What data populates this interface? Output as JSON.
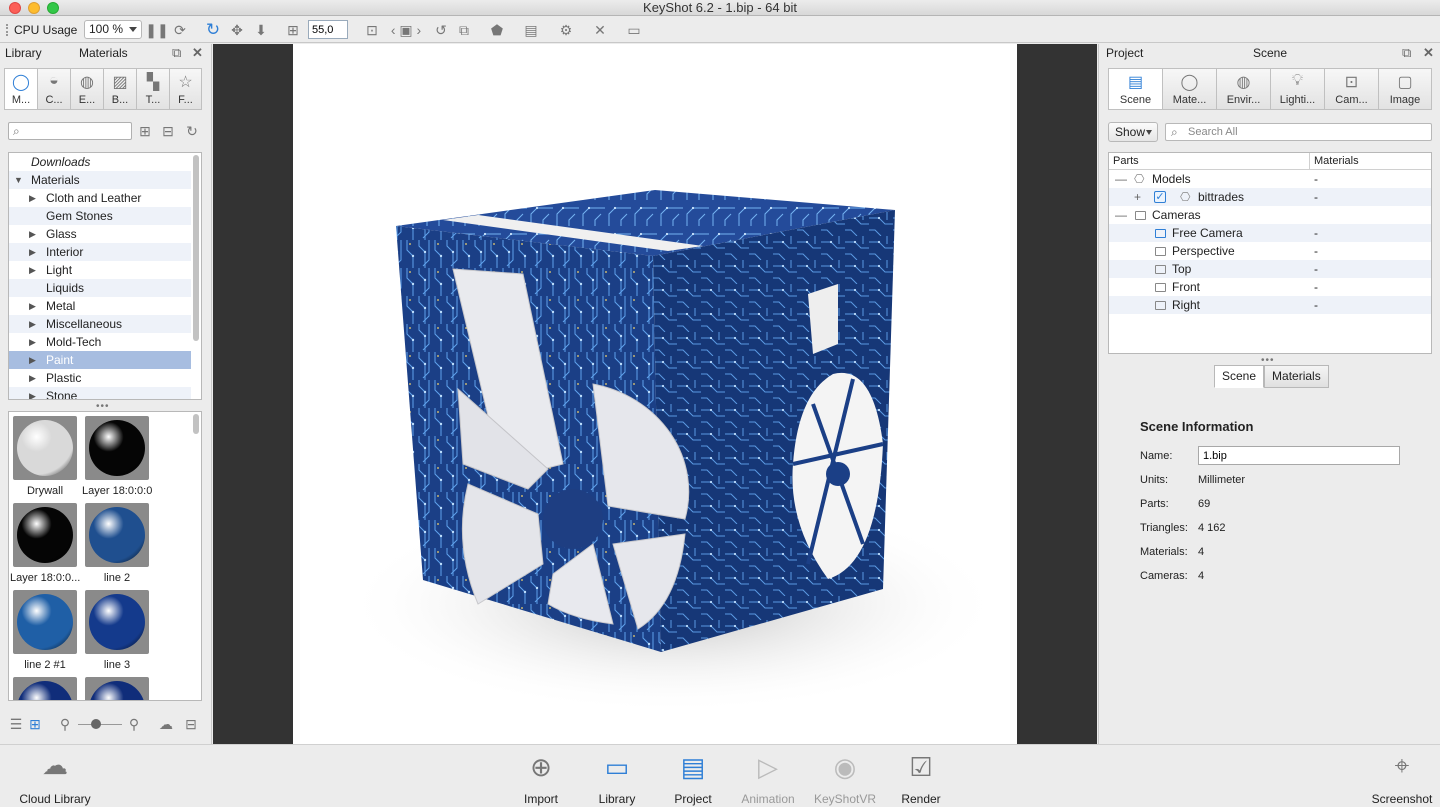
{
  "window": {
    "title": "KeyShot 6.2  - 1.bip  - 64 bit"
  },
  "toolbar": {
    "cpu_label": "CPU Usage",
    "cpu_value": "100 %",
    "fov_value": "55,0"
  },
  "library": {
    "header_left": "Library",
    "header_center": "Materials",
    "tabs": [
      {
        "label": "M...",
        "icon": "material-ball-icon",
        "active": true
      },
      {
        "label": "C...",
        "icon": "colors-icon",
        "active": false
      },
      {
        "label": "E...",
        "icon": "environment-icon",
        "active": false
      },
      {
        "label": "B...",
        "icon": "backplate-icon",
        "active": false
      },
      {
        "label": "T...",
        "icon": "texture-icon",
        "active": false
      },
      {
        "label": "F...",
        "icon": "favorites-icon",
        "active": false
      }
    ],
    "tree": [
      {
        "label": "Downloads",
        "italic": true,
        "indent": 0,
        "arrow": ""
      },
      {
        "label": "Materials",
        "indent": 0,
        "arrow": "▼"
      },
      {
        "label": "Cloth and Leather",
        "arrow": "▶"
      },
      {
        "label": "Gem Stones",
        "arrow": ""
      },
      {
        "label": "Glass",
        "arrow": "▶"
      },
      {
        "label": "Interior",
        "arrow": "▶"
      },
      {
        "label": "Light",
        "arrow": "▶"
      },
      {
        "label": "Liquids",
        "arrow": ""
      },
      {
        "label": "Metal",
        "arrow": "▶"
      },
      {
        "label": "Miscellaneous",
        "arrow": "▶"
      },
      {
        "label": "Mold-Tech",
        "arrow": "▶"
      },
      {
        "label": "Paint",
        "arrow": "▶",
        "selected": true
      },
      {
        "label": "Plastic",
        "arrow": "▶"
      },
      {
        "label": "Stone",
        "arrow": "▶"
      }
    ],
    "thumbnails": [
      {
        "label": "Drywall",
        "color": "#d9d9d9"
      },
      {
        "label": "Layer 18:0:0:0",
        "color": "#050505"
      },
      {
        "label": "Layer 18:0:0...",
        "color": "#050505"
      },
      {
        "label": "line 2",
        "color": "#1f4f8f"
      },
      {
        "label": "line 2 #1",
        "color": "#1f5fa6"
      },
      {
        "label": "line 3",
        "color": "#143a8c"
      },
      {
        "label": "",
        "color": "#102d7a"
      },
      {
        "label": "",
        "color": "#102d7a"
      }
    ]
  },
  "project": {
    "header_left": "Project",
    "header_center": "Scene",
    "tabs": [
      {
        "label": "Scene",
        "icon": "scene-list-icon",
        "active": true
      },
      {
        "label": "Mate...",
        "icon": "material-ball-icon",
        "active": false
      },
      {
        "label": "Envir...",
        "icon": "environment-icon",
        "active": false
      },
      {
        "label": "Lighti...",
        "icon": "lightbulb-icon",
        "active": false
      },
      {
        "label": "Cam...",
        "icon": "camera-icon",
        "active": false
      },
      {
        "label": "Image",
        "icon": "image-icon",
        "active": false
      }
    ],
    "show_label": "Show",
    "search_placeholder": "Search All",
    "columns": {
      "parts": "Parts",
      "materials": "Materials"
    },
    "tree": [
      {
        "label": "Models",
        "value": "-"
      },
      {
        "label": "bittrades",
        "value": "-"
      },
      {
        "label": "Cameras",
        "value": ""
      },
      {
        "label": "Free Camera",
        "value": "-"
      },
      {
        "label": "Perspective",
        "value": "-"
      },
      {
        "label": "Top",
        "value": "-"
      },
      {
        "label": "Front",
        "value": "-"
      },
      {
        "label": "Right",
        "value": "-"
      }
    ],
    "subtabs": [
      "Scene",
      "Materials"
    ],
    "info": {
      "title": "Scene Information",
      "name_label": "Name:",
      "name_value": "1.bip",
      "units_label": "Units:",
      "units_value": "Millimeter",
      "parts_label": "Parts:",
      "parts_value": "69",
      "triangles_label": "Triangles:",
      "triangles_value": "4 162",
      "materials_label": "Materials:",
      "materials_value": "4",
      "cameras_label": "Cameras:",
      "cameras_value": "4"
    }
  },
  "bottom": {
    "cloud_library": "Cloud Library",
    "import": "Import",
    "library": "Library",
    "project": "Project",
    "animation": "Animation",
    "keyshotvr": "KeyShotVR",
    "render": "Render",
    "screenshot": "Screenshot"
  }
}
